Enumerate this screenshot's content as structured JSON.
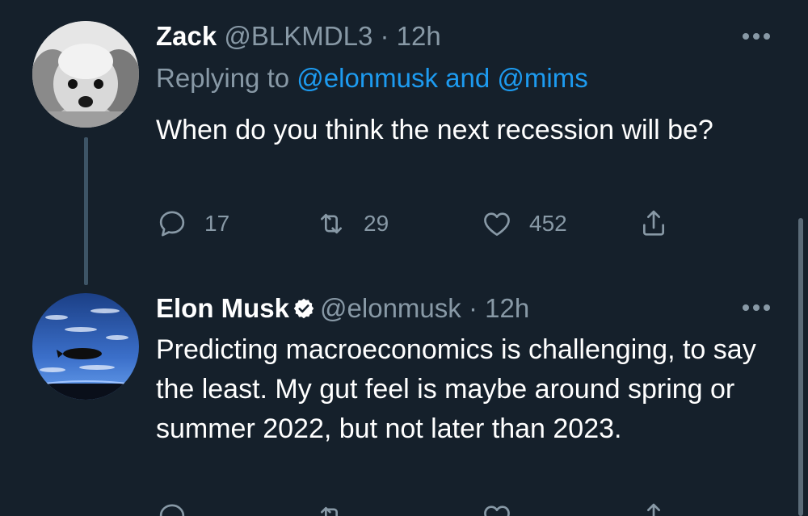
{
  "tweets": [
    {
      "display_name": "Zack",
      "handle": "@BLKMDL3",
      "separator": "·",
      "time": "12h",
      "replying_prefix": "Replying to",
      "replying_mentions": "@elonmusk and @mims",
      "text": "When do you think the next recession will be?",
      "avatar_icon": "dog-photo-avatar",
      "counts": {
        "reply": "17",
        "retweet": "29",
        "like": "452"
      }
    },
    {
      "display_name": "Elon Musk",
      "verified_icon": "verified-badge-icon",
      "handle": "@elonmusk",
      "separator": "·",
      "time": "12h",
      "text": "Predicting macroeconomics is challenging, to say the least. My gut feel is maybe around spring or summer 2022, but not later than 2023.",
      "avatar_icon": "earth-orbit-avatar",
      "counts": {
        "reply": "",
        "retweet": "",
        "like": ""
      }
    }
  ],
  "colors": {
    "background": "#15202b",
    "text": "#ffffff",
    "secondary": "#8899a6",
    "link": "#1d9bf0"
  }
}
